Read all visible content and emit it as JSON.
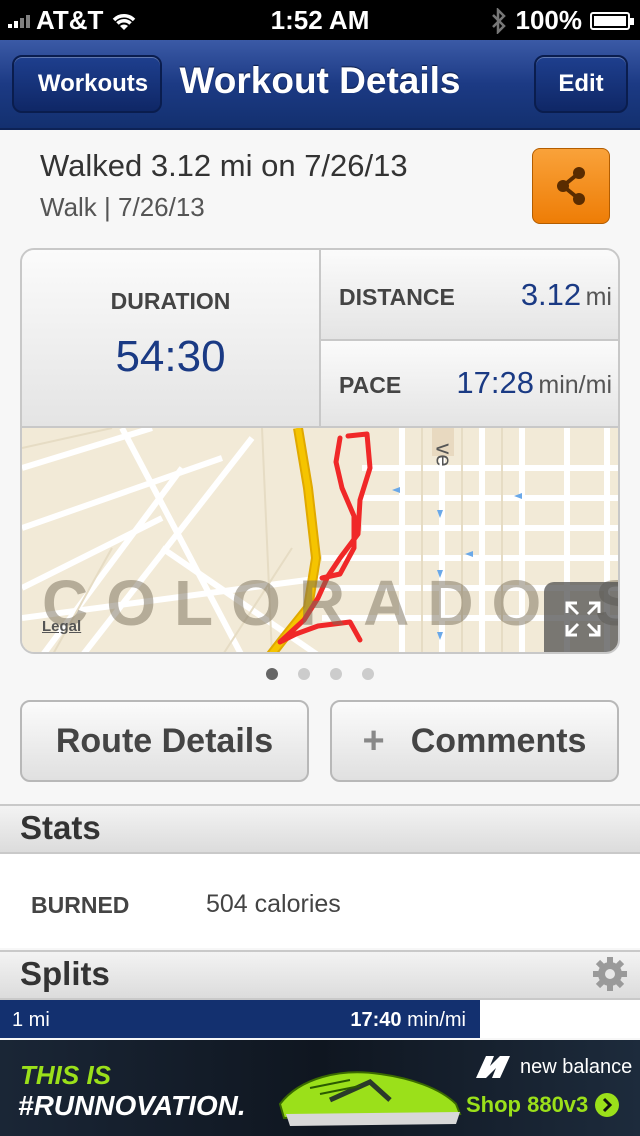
{
  "status_bar": {
    "carrier": "AT&T",
    "time": "1:52 AM",
    "battery": "100%"
  },
  "nav": {
    "back_label": "Workouts",
    "title": "Workout Details",
    "edit_label": "Edit"
  },
  "workout": {
    "title": "Walked 3.12 mi on 7/26/13",
    "subtitle": "Walk | 7/26/13"
  },
  "stats_card": {
    "duration_label": "DURATION",
    "duration_value": "54:30",
    "distance_label": "DISTANCE",
    "distance_value": "3.12",
    "distance_unit": "mi",
    "pace_label": "PACE",
    "pace_value": "17:28",
    "pace_unit": "min/mi"
  },
  "map": {
    "city_label": "COLORADO SPR",
    "street_label": "ve",
    "legal_label": "Legal"
  },
  "pager": {
    "pages": 4,
    "active": 0
  },
  "actions": {
    "route_details_label": "Route Details",
    "comments_plus": "+",
    "comments_label": "Comments"
  },
  "stats_section": {
    "header": "Stats",
    "burned_label": "BURNED",
    "burned_value": "504 calories"
  },
  "splits_section": {
    "header": "Splits",
    "split_label": "1 mi",
    "split_value": "17:40",
    "split_unit": "min/mi"
  },
  "ad": {
    "line1": "THIS IS",
    "line2": "#RUNNOVATION.",
    "brand": "new balance",
    "cta": "Shop 880v3"
  },
  "colors": {
    "nav_blue": "#1c3a84",
    "share_orange": "#ee7d06",
    "value_blue": "#1a3a84",
    "route_red": "#f02828",
    "road_yellow": "#f5c400",
    "ad_green": "#9be01a"
  }
}
